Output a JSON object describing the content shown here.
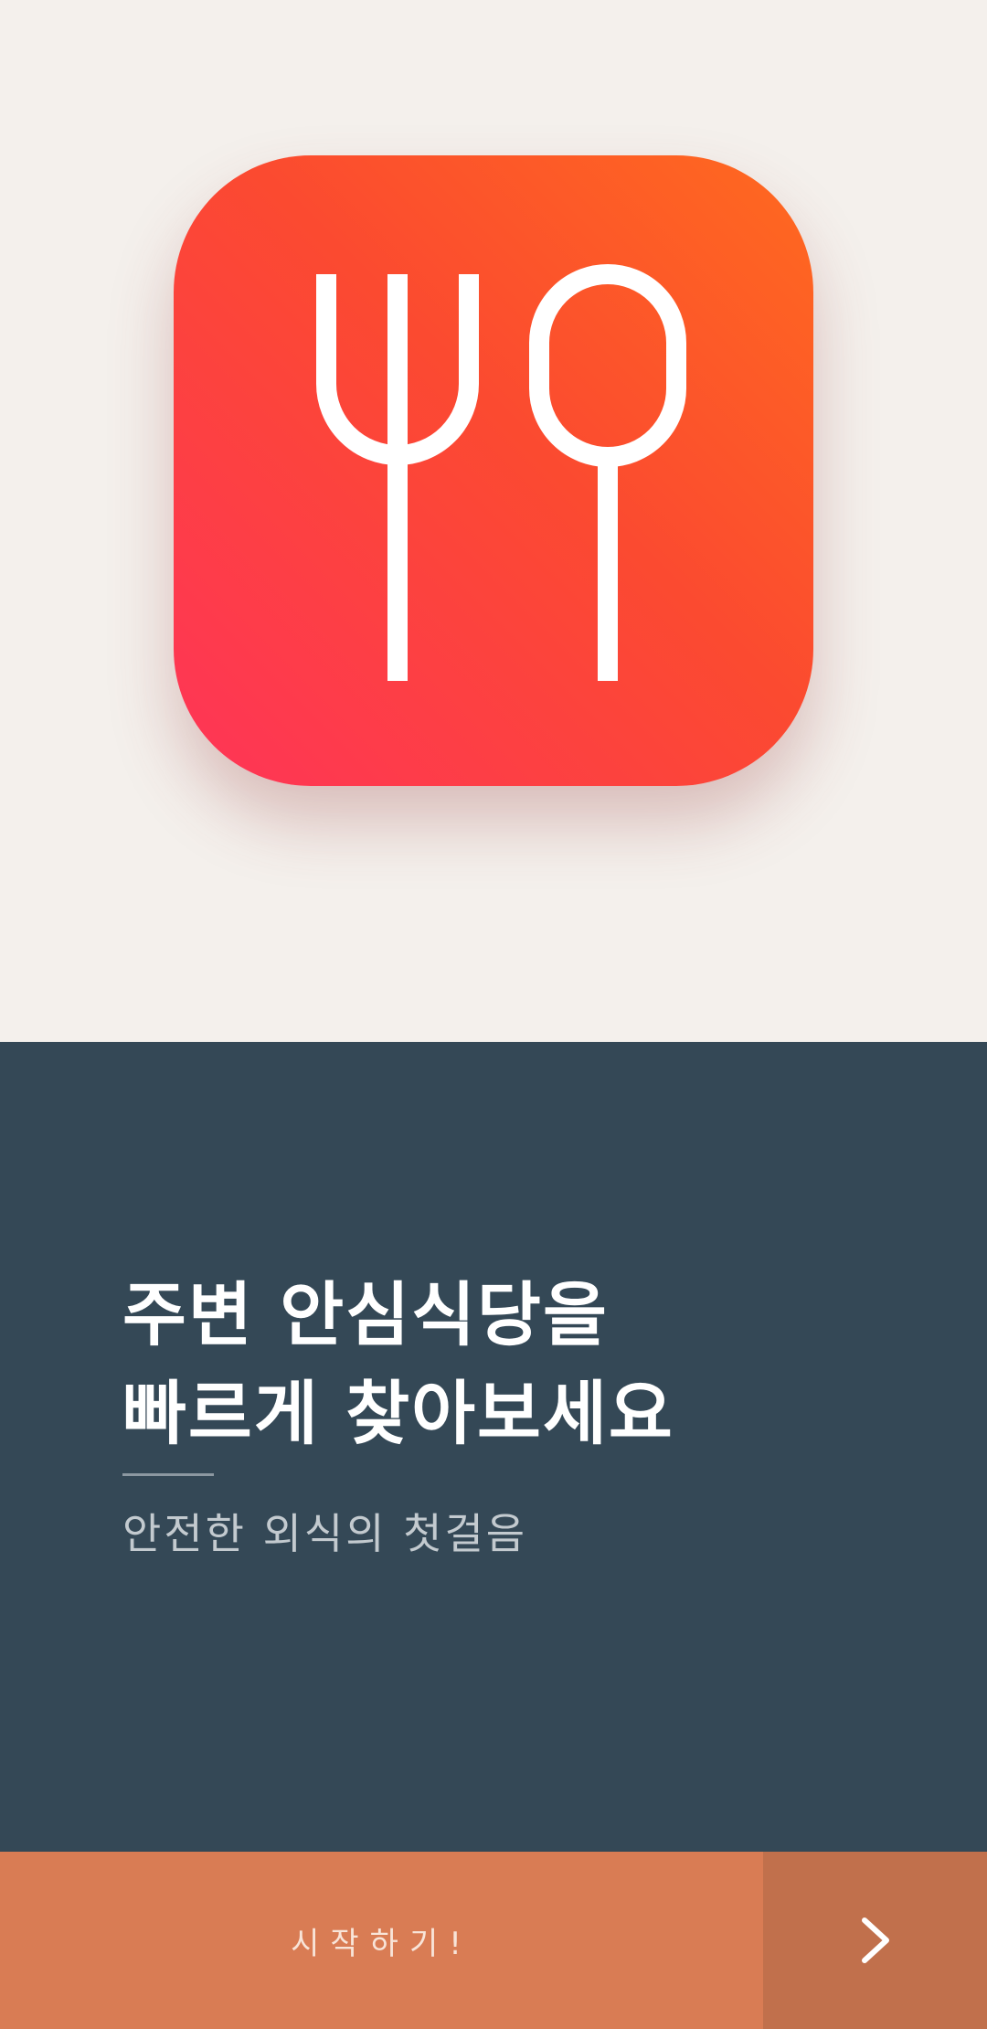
{
  "onboarding": {
    "logo_icon": "fork-and-spoon-icon",
    "headline": {
      "line1": "주변 안심식당을",
      "line2": "빠르게 찾아보세요"
    },
    "subtitle": "안전한 외식의 첫걸음",
    "start_label": "시작하기!",
    "next_icon": "chevron-right-icon"
  },
  "colors": {
    "hero_background": "#f4f0ec",
    "icon_gradient_top": "#ff6a1f",
    "icon_gradient_bottom": "#ff3458",
    "panel_background": "#344856",
    "start_bar": "#d97c54",
    "next_button": "#c1704c"
  }
}
